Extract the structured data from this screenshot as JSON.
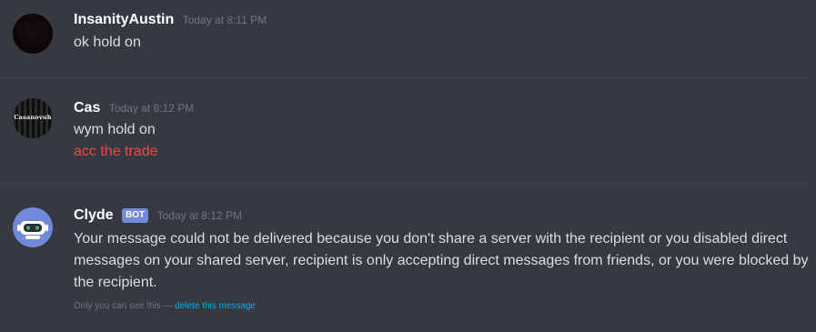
{
  "messages": [
    {
      "username": "InsanityAustin",
      "timestamp": "Today at 8:11 PM",
      "lines": [
        "ok hold on"
      ]
    },
    {
      "username": "Cas",
      "timestamp": "Today at 8:12 PM",
      "avatar_text": "Casanovuh",
      "lines": [
        "wym hold on",
        "acc the trade"
      ]
    },
    {
      "username": "Clyde",
      "bot_tag": "BOT",
      "timestamp": "Today at 8:12 PM",
      "text": "Your message could not be delivered because you don't share a server with the recipient or you disabled direct messages on your shared server, recipient is only accepting direct messages from friends, or you were blocked by the recipient.",
      "ephemeral_note": "Only you can see this — ",
      "ephemeral_link": "delete this message"
    }
  ],
  "colors": {
    "background": "#36393f",
    "username": "#ffffff",
    "text": "#dcddde",
    "timestamp": "#72767d",
    "red_text": "#f04747",
    "bot_tag": "#7289da",
    "link": "#00b0f4"
  }
}
